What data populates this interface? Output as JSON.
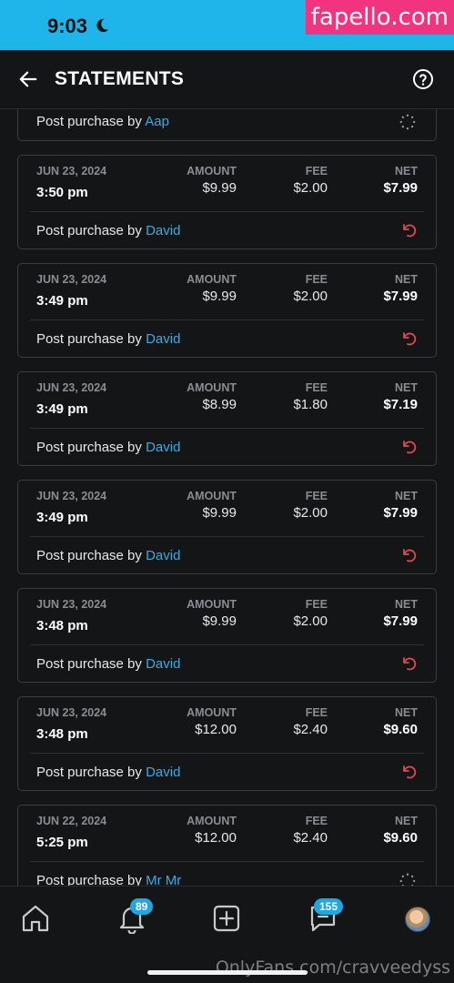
{
  "status_bar": {
    "time": "9:03"
  },
  "watermark": "fapello.com",
  "header": {
    "title": "STATEMENTS"
  },
  "columns": {
    "amount": "AMOUNT",
    "fee": "FEE",
    "net": "NET"
  },
  "desc_prefix": "Post purchase by",
  "partial_top": {
    "user": "Aap"
  },
  "transactions": [
    {
      "date": "JUN 23, 2024",
      "time": "3:50 pm",
      "amount": "$9.99",
      "fee": "$2.00",
      "net": "$7.99",
      "user": "David",
      "status_icon": "refund-icon"
    },
    {
      "date": "JUN 23, 2024",
      "time": "3:49 pm",
      "amount": "$9.99",
      "fee": "$2.00",
      "net": "$7.99",
      "user": "David",
      "status_icon": "refund-icon"
    },
    {
      "date": "JUN 23, 2024",
      "time": "3:49 pm",
      "amount": "$8.99",
      "fee": "$1.80",
      "net": "$7.19",
      "user": "David",
      "status_icon": "refund-icon"
    },
    {
      "date": "JUN 23, 2024",
      "time": "3:49 pm",
      "amount": "$9.99",
      "fee": "$2.00",
      "net": "$7.99",
      "user": "David",
      "status_icon": "refund-icon"
    },
    {
      "date": "JUN 23, 2024",
      "time": "3:48 pm",
      "amount": "$9.99",
      "fee": "$2.00",
      "net": "$7.99",
      "user": "David",
      "status_icon": "refund-icon"
    },
    {
      "date": "JUN 23, 2024",
      "time": "3:48 pm",
      "amount": "$12.00",
      "fee": "$2.40",
      "net": "$9.60",
      "user": "David",
      "status_icon": "refund-icon"
    },
    {
      "date": "JUN 22, 2024",
      "time": "5:25 pm",
      "amount": "$12.00",
      "fee": "$2.40",
      "net": "$9.60",
      "user": "Mr Mr",
      "status_icon": "pending-icon"
    }
  ],
  "bottom_nav": {
    "items": [
      "home-icon",
      "bell-icon",
      "add-post-icon",
      "messages-icon",
      "avatar"
    ],
    "notifications_badge": "89",
    "messages_badge": "155"
  },
  "footer_watermark": "OnlyFans.com/cravveedyss",
  "colors": {
    "accent": "#1fb5ea",
    "link": "#3fa9df",
    "refund": "#e0484d",
    "background": "#141517",
    "watermark_bg": "#f2347f"
  }
}
